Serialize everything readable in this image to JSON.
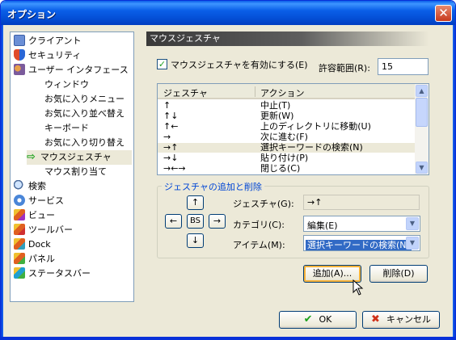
{
  "window": {
    "title": "オプション",
    "close_label": "✕"
  },
  "tree": {
    "items": [
      {
        "label": "クライアント",
        "icon": "monitor-icon",
        "level": 0
      },
      {
        "label": "セキュリティ",
        "icon": "shield-icon",
        "level": 0
      },
      {
        "label": "ユーザー インタフェース",
        "icon": "users-icon",
        "level": 0
      },
      {
        "label": "ウィンドウ",
        "level": 1
      },
      {
        "label": "お気に入りメニュー",
        "level": 1
      },
      {
        "label": "お気に入り並べ替え",
        "level": 1
      },
      {
        "label": "キーボード",
        "level": 1
      },
      {
        "label": "お気に入り切り替え",
        "level": 1
      },
      {
        "label": "マウスジェスチャ",
        "level": 1,
        "selected": true
      },
      {
        "label": "マウス割り当て",
        "level": 1
      },
      {
        "label": "検索",
        "icon": "search-icon",
        "level": 0
      },
      {
        "label": "サービス",
        "icon": "gear-icon",
        "level": 0
      },
      {
        "label": "ビュー",
        "icon": "cube-icon",
        "level": 0
      },
      {
        "label": "ツールバー",
        "icon": "cube-icon",
        "level": 0
      },
      {
        "label": "Dock",
        "icon": "cube-icon",
        "level": 0
      },
      {
        "label": "パネル",
        "icon": "cube-icon",
        "level": 0
      },
      {
        "label": "ステータスバー",
        "icon": "cube-icon",
        "level": 0
      }
    ]
  },
  "pane": {
    "header": "マウスジェスチャ",
    "enable_checkbox": {
      "label": "マウスジェスチャを有効にする(E)",
      "checked": true
    },
    "range": {
      "label": "許容範囲(R):",
      "value": "15"
    },
    "list": {
      "columns": [
        "ジェスチャ",
        "アクション"
      ],
      "rows": [
        {
          "gesture": "↑",
          "action": "中止(T)"
        },
        {
          "gesture": "↑↓",
          "action": "更新(W)"
        },
        {
          "gesture": "↑←",
          "action": "上のディレクトリに移動(U)"
        },
        {
          "gesture": "→",
          "action": "次に進む(F)"
        },
        {
          "gesture": "→↑",
          "action": "選択キーワードの検索(N)",
          "selected": true
        },
        {
          "gesture": "→↓",
          "action": "貼り付け(P)"
        },
        {
          "gesture": "→←→",
          "action": "閉じる(C)"
        }
      ]
    },
    "group": {
      "title": "ジェスチャの追加と削除",
      "arrows": {
        "up": "↑",
        "left": "←",
        "bs": "BS",
        "right": "→",
        "down": "↓"
      },
      "gesture_label": "ジェスチャ(G):",
      "gesture_value": "→↑",
      "category_label": "カテゴリ(C):",
      "category_value": "編集(E)",
      "item_label": "アイテム(M):",
      "item_value": "選択キーワードの検索(N)"
    },
    "add_button": "追加(A)...",
    "delete_button": "削除(D)"
  },
  "footer": {
    "ok": "OK",
    "cancel": "キャンセル"
  },
  "colors": {
    "title_bar": "#0a5fe8",
    "selection": "#316ac5",
    "group_title": "#0046d5"
  }
}
